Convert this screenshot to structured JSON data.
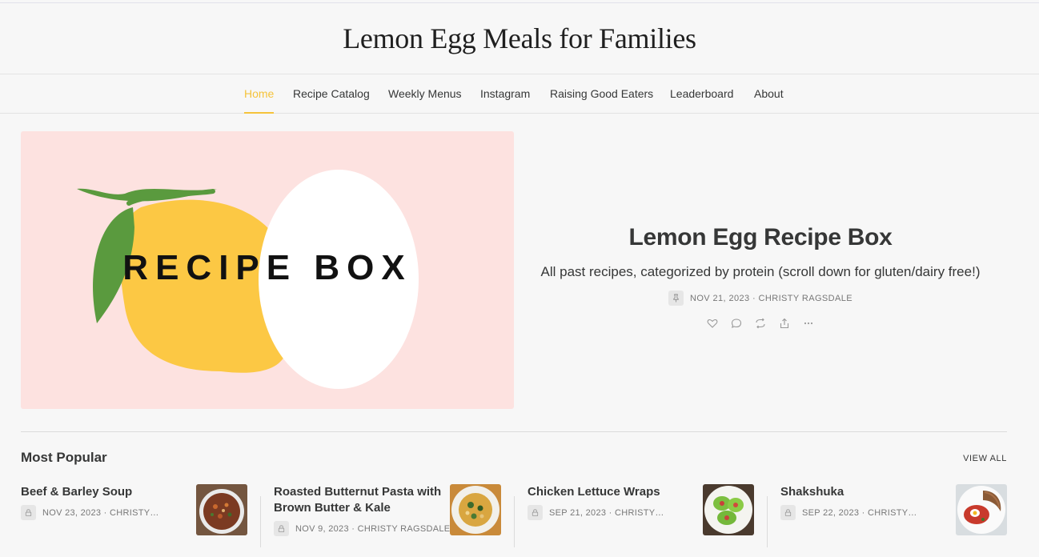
{
  "site": {
    "title": "Lemon Egg Meals for Families"
  },
  "nav": {
    "items": [
      {
        "label": "Home",
        "active": true
      },
      {
        "label": "Recipe Catalog",
        "active": false
      },
      {
        "label": "Weekly Menus",
        "active": false
      },
      {
        "label": "Instagram",
        "active": false
      },
      {
        "label": "Raising Good Eaters",
        "active": false
      },
      {
        "label": "Leaderboard",
        "active": false
      },
      {
        "label": "About",
        "active": false
      }
    ]
  },
  "hero": {
    "image_text": "RECIPE BOX",
    "title": "Lemon Egg Recipe Box",
    "subtitle": "All past recipes, categorized by protein (scroll down for gluten/dairy free!)",
    "date": "NOV 21, 2023",
    "author": "CHRISTY RAGSDALE",
    "meta_separator": "·",
    "badge_icon": "pin-icon",
    "actions": [
      "heart-icon",
      "comment-icon",
      "restack-icon",
      "share-icon",
      "more-icon"
    ]
  },
  "popular": {
    "heading": "Most Popular",
    "view_all": "VIEW ALL",
    "posts": [
      {
        "title": "Beef & Barley Soup",
        "date": "NOV 23, 2023",
        "author": "CHRISTY…",
        "thumb_icon": "soup-bowl-image"
      },
      {
        "title": "Roasted Butternut Pasta with Brown Butter & Kale",
        "date": "NOV 9, 2023",
        "author": "CHRISTY RAGSDALE",
        "thumb_icon": "pasta-plate-image"
      },
      {
        "title": "Chicken Lettuce Wraps",
        "date": "SEP 21, 2023",
        "author": "CHRISTY…",
        "thumb_icon": "lettuce-wraps-image"
      },
      {
        "title": "Shakshuka",
        "date": "SEP 22, 2023",
        "author": "CHRISTY…",
        "thumb_icon": "shakshuka-plate-image"
      }
    ]
  },
  "colors": {
    "accent": "#f5c33b",
    "background": "#f7f7f7",
    "hero_image_bg": "#fde2e0",
    "lemon": "#fcc844",
    "leaf": "#5a9a3e"
  }
}
